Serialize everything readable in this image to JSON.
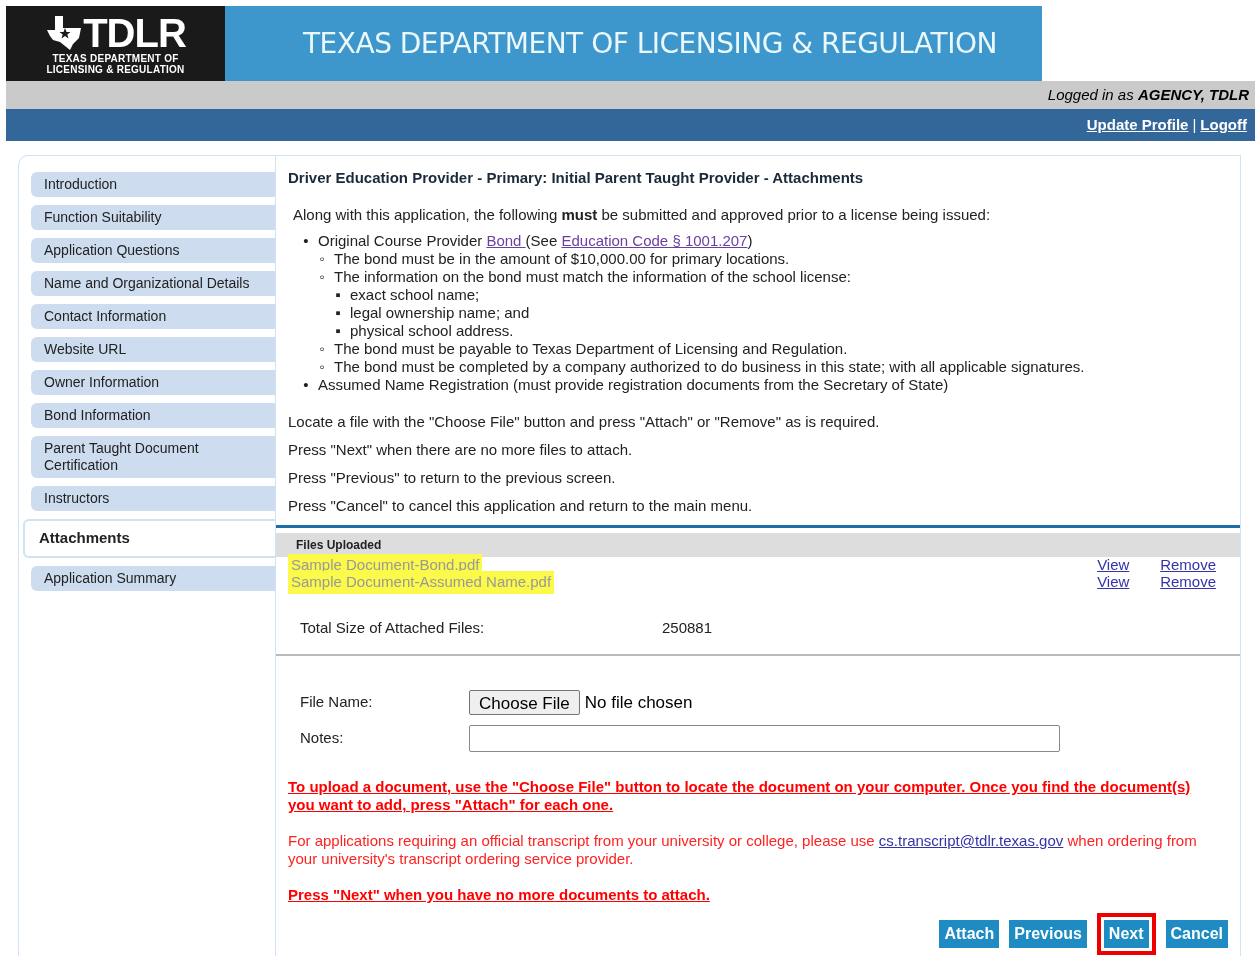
{
  "header": {
    "logo_text": "TDLR",
    "logo_subtitle": [
      "TEXAS DEPARTMENT OF",
      "LICENSING & REGULATION"
    ],
    "banner_title": "TEXAS DEPARTMENT OF LICENSING & REGULATION"
  },
  "user_bar": {
    "prefix": "Logged in as",
    "user": "AGENCY, TDLR"
  },
  "links_bar": [
    {
      "label": "Update Profile"
    },
    {
      "label": "Logoff"
    }
  ],
  "links_separator": "|",
  "sidebar": {
    "items": [
      {
        "label": "Introduction",
        "selected": false
      },
      {
        "label": "Function Suitability",
        "selected": false
      },
      {
        "label": "Application Questions",
        "selected": false
      },
      {
        "label": "Name and Organizational Details",
        "selected": false
      },
      {
        "label": "Contact Information",
        "selected": false
      },
      {
        "label": "Website URL",
        "selected": false
      },
      {
        "label": "Owner Information",
        "selected": false
      },
      {
        "label": "Bond Information",
        "selected": false
      },
      {
        "label": "Parent Taught Document Certification",
        "selected": false
      },
      {
        "label": "Instructors",
        "selected": false
      },
      {
        "label": "Attachments",
        "selected": true
      },
      {
        "label": "Application Summary",
        "selected": false
      }
    ]
  },
  "page_title": "Driver Education Provider - Primary: Initial Parent Taught Provider - Attachments",
  "intro": "Along with this application, the following **must** be submitted and approved prior to a license being issued:",
  "requirements": [
    {
      "marker": "•",
      "parts": [
        {
          "text": "Original Course Provider "
        },
        {
          "link": "Bond "
        },
        {
          "text": "(See "
        },
        {
          "link": "Education Code § 1001.207"
        },
        {
          "text": ")"
        }
      ],
      "children": [
        {
          "marker": "◦",
          "parts": [
            {
              "text": "The bond must be in the amount of $10,000.00 for primary locations."
            }
          ]
        },
        {
          "marker": "◦",
          "parts": [
            {
              "text": "The information on the bond must match the information of the school license:"
            }
          ],
          "children": [
            {
              "marker": "▪",
              "parts": [
                {
                  "text": "exact school name;"
                }
              ]
            },
            {
              "marker": "▪",
              "parts": [
                {
                  "text": "legal ownership name; and"
                }
              ]
            },
            {
              "marker": "▪",
              "parts": [
                {
                  "text": "physical school address."
                }
              ]
            }
          ]
        },
        {
          "marker": "◦",
          "parts": [
            {
              "text": "The bond must be payable to Texas Department of Licensing and Regulation."
            }
          ]
        },
        {
          "marker": "◦",
          "parts": [
            {
              "text": "The bond must be completed by a company authorized to do business in this state; with all applicable signatures."
            }
          ]
        }
      ]
    },
    {
      "marker": "•",
      "parts": [
        {
          "text": "Assumed Name Registration (must provide registration documents from the Secretary of State)"
        }
      ]
    }
  ],
  "instructions": [
    "Locate a file with the \"Choose File\" button and press \"Attach\" or \"Remove\" as is required.",
    "Press \"Next\" when there are no more files to attach.",
    "Press \"Previous\" to return to the previous screen.",
    "Press \"Cancel\" to cancel this application and return to the main menu."
  ],
  "files": {
    "heading": "Files Uploaded",
    "rows": [
      {
        "name": "Sample Document-Bond.pdf",
        "highlighted": true,
        "view": "View",
        "remove": "Remove"
      },
      {
        "name": "Sample Document-Assumed Name.pdf",
        "highlighted": true,
        "view": "View",
        "remove": "Remove"
      }
    ],
    "total_label": "Total Size of Attached Files:",
    "total_value": "250881"
  },
  "form": {
    "file_label": "File Name:",
    "choose_button": "Choose File",
    "file_status": "No file chosen",
    "notes_label": "Notes:"
  },
  "notices": [
    {
      "kind": "warning",
      "parts": [
        {
          "text": "To upload a document, use the \"Choose File\" button to locate the document on your computer. Once you find the document(s) you want to add, press \"Attach\" for each one."
        }
      ]
    },
    {
      "kind": "info",
      "parts": [
        {
          "text": "For applications requiring an official transcript from your university or college, please use "
        },
        {
          "link": "cs.transcript@tdlr.texas.gov"
        },
        {
          "text": " when ordering from your university's transcript ordering service provider."
        }
      ]
    },
    {
      "kind": "warning",
      "parts": [
        {
          "text": "Press \"Next\" when you have no more documents to attach."
        }
      ]
    }
  ],
  "buttons": [
    {
      "label": "Attach",
      "highlighted": false
    },
    {
      "label": "Previous",
      "highlighted": false
    },
    {
      "label": "Next",
      "highlighted": true
    },
    {
      "label": "Cancel",
      "highlighted": false
    }
  ]
}
